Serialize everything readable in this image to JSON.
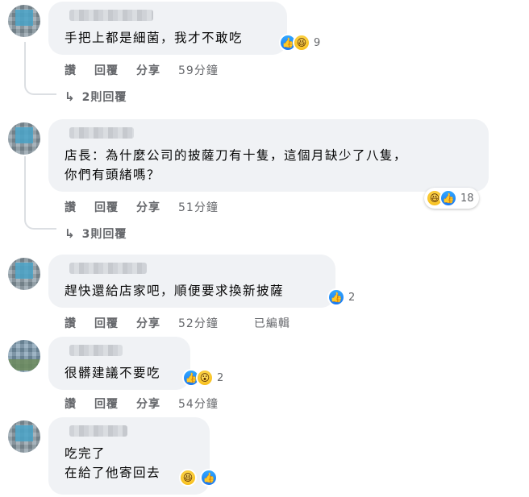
{
  "comments": [
    {
      "text_lines": [
        "手把上都是細菌，我才不敢吃"
      ],
      "reaction_count": "9",
      "reaction_icons": [
        "like-icon",
        "haha-icon"
      ],
      "actions": {
        "like": "讚",
        "reply": "回覆",
        "share": "分享",
        "time": "59分鐘"
      },
      "replies_label": "2則回覆"
    },
    {
      "text_lines": [
        "店長：為什麼公司的披薩刀有十隻，這個月缺少了八隻，",
        "你們有頭緒嗎？"
      ],
      "reaction_count": "18",
      "reaction_icons": [
        "haha-icon",
        "like-icon"
      ],
      "actions": {
        "like": "讚",
        "reply": "回覆",
        "share": "分享",
        "time": "51分鐘"
      },
      "replies_label": "3則回覆"
    },
    {
      "text_lines": [
        "趕快還給店家吧，順便要求換新披薩"
      ],
      "reaction_count": "2",
      "reaction_icons": [
        "like-icon"
      ],
      "actions": {
        "like": "讚",
        "reply": "回覆",
        "share": "分享",
        "time": "52分鐘",
        "edited": "已編輯"
      }
    },
    {
      "text_lines": [
        "很髒建議不要吃"
      ],
      "reaction_count": "2",
      "reaction_icons": [
        "like-icon",
        "wow-icon"
      ],
      "actions": {
        "like": "讚",
        "reply": "回覆",
        "share": "分享",
        "time": "54分鐘"
      }
    },
    {
      "text_lines": [
        "吃完了",
        "在給了他寄回去"
      ],
      "reaction_icons": [
        "haha-icon",
        "like-icon"
      ]
    }
  ],
  "colors": {
    "bubble": "#f0f2f5",
    "action_text": "#65676b",
    "like_blue": "#1877f2",
    "emoji_yellow": "#f5b300"
  }
}
